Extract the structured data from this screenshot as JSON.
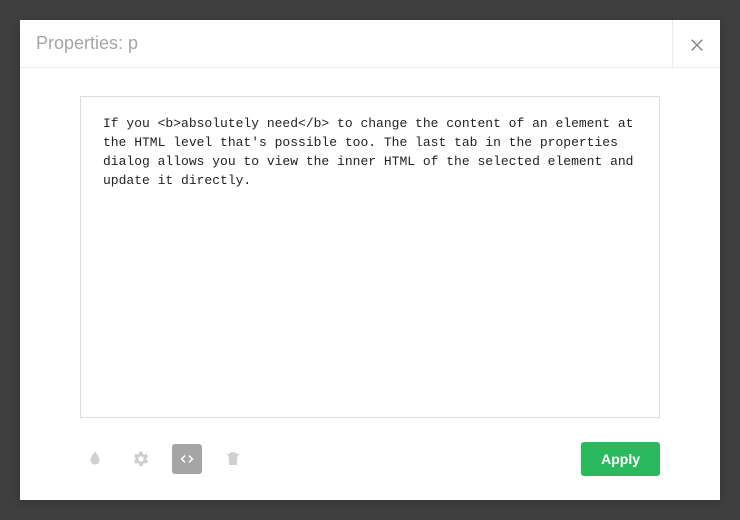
{
  "header": {
    "title": "Properties: p"
  },
  "editor": {
    "content": "If you <b>absolutely need</b> to change the content of an element at the HTML level that's possible too. The last tab in the properties dialog allows you to view the inner HTML of the selected element and update it directly."
  },
  "tabs": {
    "style_icon": "droplet",
    "settings_icon": "gear",
    "code_icon": "code",
    "delete_icon": "trash",
    "active": "code"
  },
  "actions": {
    "apply_label": "Apply"
  }
}
